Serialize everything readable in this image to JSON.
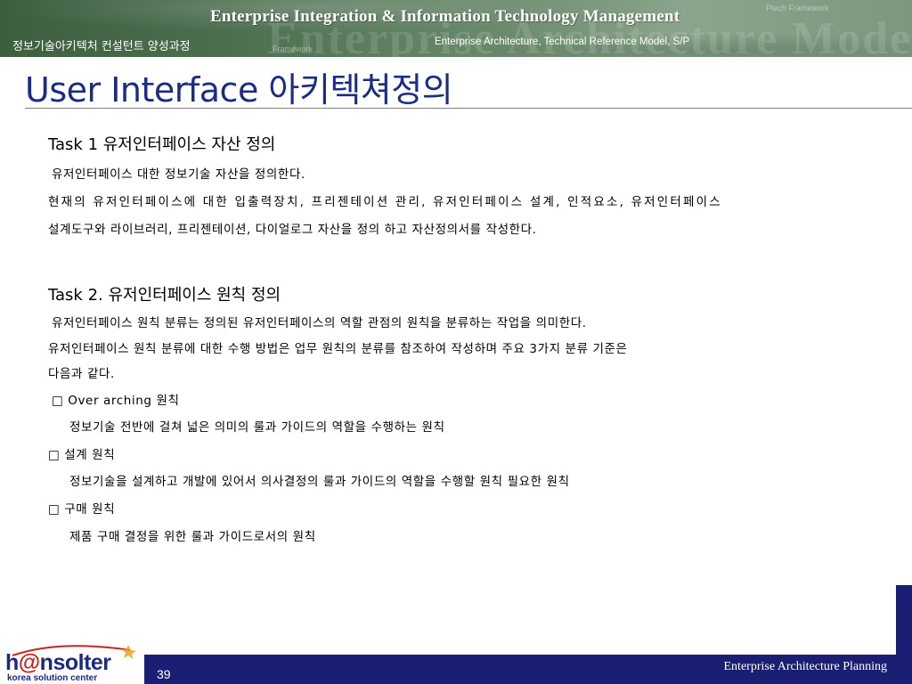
{
  "header": {
    "title": "Enterprise Integration & Information Technology Management",
    "course_name": "정보기술아키텍처 컨설턴트 양성과정",
    "subtitle": "Enterprise Architecture, Technical Reference Model, S/P",
    "watermark": "Enterprise Architecture Model",
    "watermark_small_1": "Ptech Framework",
    "watermark_small_2": "Framework"
  },
  "slide": {
    "title": "User Interface 아키텍쳐정의"
  },
  "task1": {
    "heading": "Task 1 유저인터페이스 자산 정의",
    "line1": "유저인터페이스 대한 정보기술 자산을 정의한다.",
    "line2": "현재의 유저인터페이스에 대한 입출력장치, 프리젠테이션 관리, 유저인터페이스 설계, 인적요소, 유저인터페이스",
    "line3": "설계도구와 라이브러리, 프리젠테이션, 다이얼로그  자산을 정의 하고 자산정의서를 작성한다."
  },
  "task2": {
    "heading": "Task 2. 유저인터페이스 원칙 정의",
    "line1": "유저인터페이스 원칙 분류는 정의된 유저인터페이스의 역할 관점의 원칙을 분류하는 작업을 의미한다.",
    "line2": "유저인터페이스  원칙 분류에 대한 수행 방법은 업무 원칙의 분류를 참조하여 작성하며 주요 3가지 분류 기준은",
    "line3": "다음과 같다.",
    "items": [
      {
        "label": "□ Over arching 원칙",
        "desc": "정보기술 전반에 걸쳐 넓은 의미의 룰과 가이드의 역할을 수행하는 원칙"
      },
      {
        "label": "□ 설계 원칙",
        "desc": "정보기술을 설계하고 개발에 있어서 의사결정의 룰과 가이드의 역할을 수행할 원칙 필요한 원칙"
      },
      {
        "label": "□ 구매 원칙",
        "desc": "제품 구매 결정을 위한 룰과 가이드로서의 원칙"
      }
    ]
  },
  "footer": {
    "page_number": "39",
    "label": "Enterprise Architecture Planning",
    "logo_prefix": "h",
    "logo_at": "@",
    "logo_suffix": "nsolter",
    "logo_tagline": "korea solution center"
  },
  "colors": {
    "title": "#1a2b88",
    "footer_bar": "#1b1f73",
    "banner": "#4c6f4f"
  }
}
